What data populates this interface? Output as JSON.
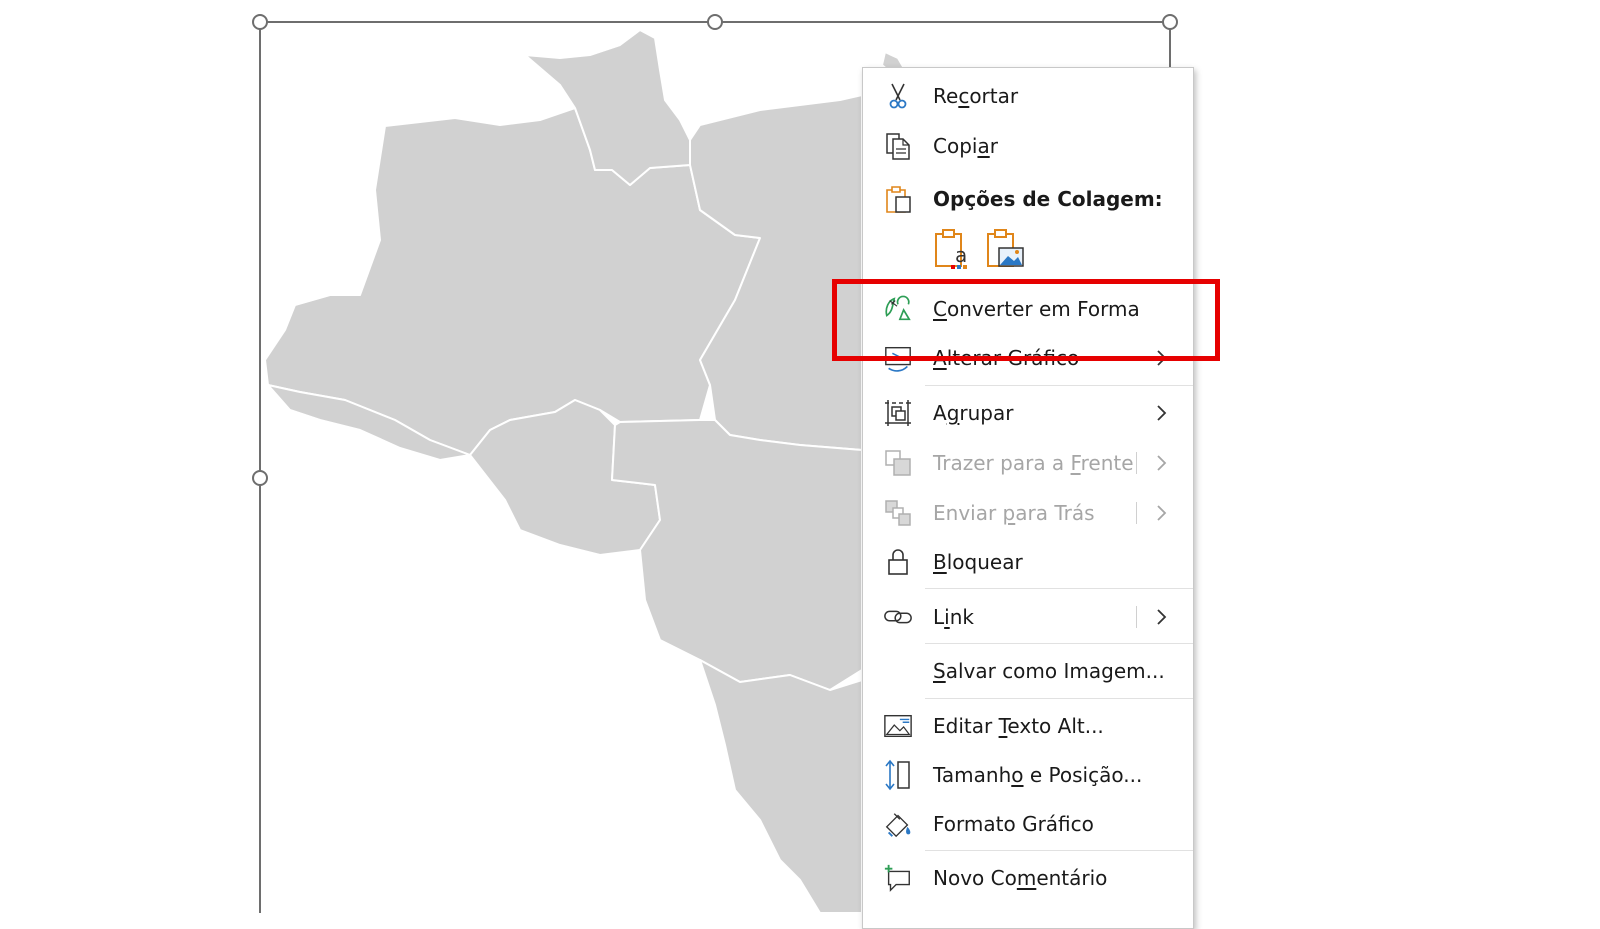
{
  "context_menu": {
    "items": [
      {
        "id": "recortar",
        "pre": "Re",
        "key": "c",
        "post": "ortar",
        "icon": "scissors-icon"
      },
      {
        "id": "copiar",
        "pre": "Copi",
        "key": "a",
        "post": "r",
        "icon": "copy-icon"
      },
      {
        "id": "paste-options",
        "pre": "",
        "key": "",
        "post": "Opções de Colagem:",
        "icon": "clipboard-icon"
      },
      {
        "id": "converter",
        "pre": "",
        "key": "C",
        "post": "onverter em Forma",
        "icon": "convert-to-shape-icon"
      },
      {
        "id": "alterar",
        "pre": "",
        "key": "A",
        "post": "lterar Gráfico",
        "icon": "change-graphic-icon"
      },
      {
        "id": "agrupar",
        "pre": "A",
        "key": "g",
        "post": "rupar",
        "icon": "group-icon"
      },
      {
        "id": "trazer",
        "pre": "Trazer para a ",
        "key": "F",
        "post": "rente",
        "icon": "bring-to-front-icon"
      },
      {
        "id": "enviar",
        "pre": "Enviar ",
        "key": "p",
        "post": "ara Trás",
        "icon": "send-to-back-icon"
      },
      {
        "id": "bloquear",
        "pre": "",
        "key": "B",
        "post": "loquear",
        "icon": "lock-icon"
      },
      {
        "id": "link",
        "pre": "L",
        "key": "i",
        "post": "nk",
        "icon": "link-icon"
      },
      {
        "id": "salvar",
        "pre": "",
        "key": "S",
        "post": "alvar como Imagem...",
        "icon": ""
      },
      {
        "id": "editar",
        "pre": "Editar ",
        "key": "T",
        "post": "exto Alt...",
        "icon": "alt-text-icon"
      },
      {
        "id": "tamanho",
        "pre": "Tamanh",
        "key": "o",
        "post": " e Posição...",
        "icon": "size-position-icon"
      },
      {
        "id": "formato",
        "pre": "Formato Gráfico",
        "key": "",
        "post": "",
        "icon": "format-graphic-icon"
      },
      {
        "id": "comentario",
        "pre": "Novo Co",
        "key": "m",
        "post": "entário",
        "icon": "new-comment-icon"
      }
    ],
    "paste_buttons": [
      {
        "id": "keep-text",
        "icon": "paste-text-icon"
      },
      {
        "id": "as-picture",
        "icon": "paste-picture-icon"
      }
    ]
  },
  "colors": {
    "map_fill": "#d1d1d1",
    "map_border": "#ffffff",
    "highlight": "#e60000",
    "selection": "#6e6e6e",
    "icon_blue": "#2b78c5",
    "icon_orange": "#e0861a",
    "icon_green": "#2e9e56",
    "disabled_text": "#a6a6a6"
  }
}
